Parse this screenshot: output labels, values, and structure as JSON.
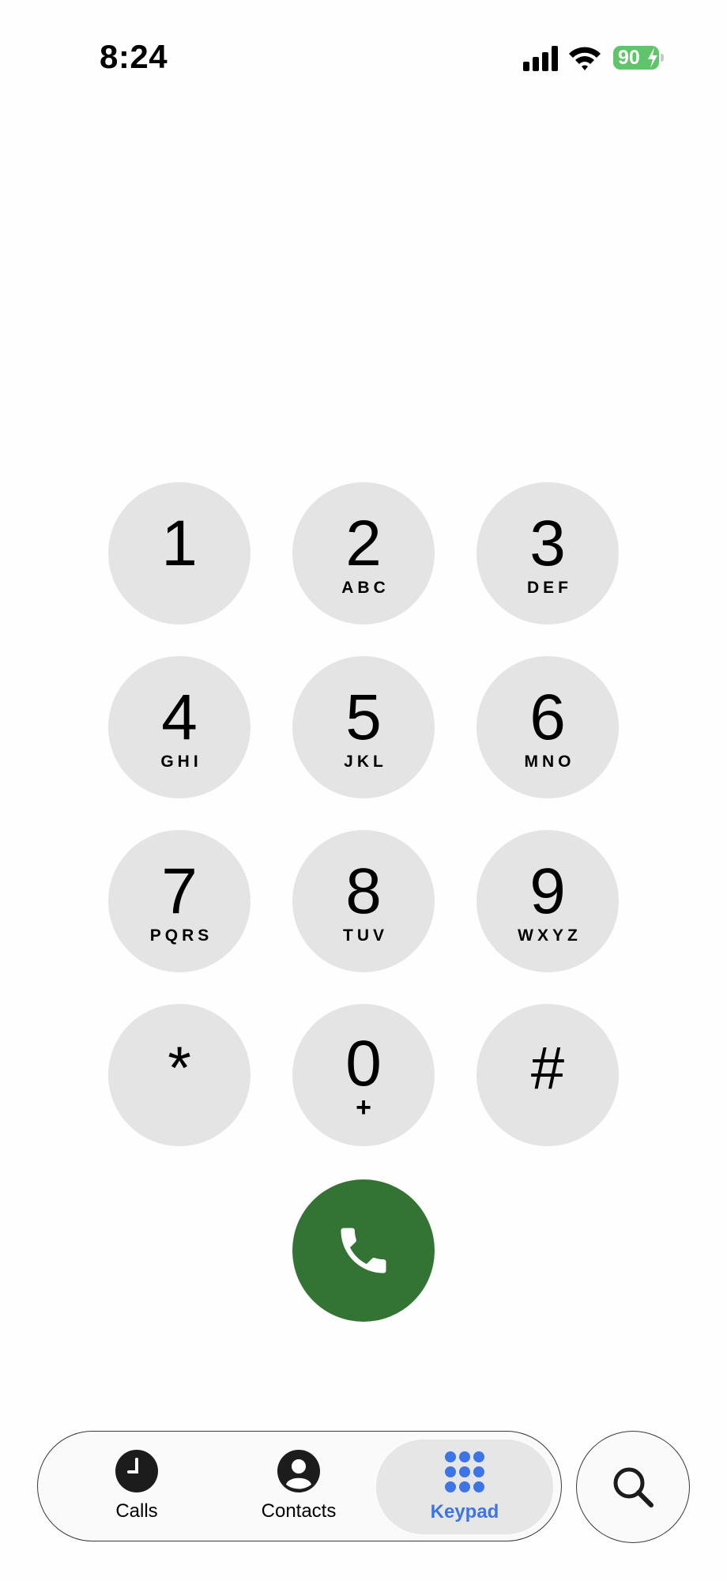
{
  "status_bar": {
    "time": "8:24",
    "battery_level": "90",
    "icons": [
      "cellular-signal-icon",
      "wifi-icon",
      "battery-charging-icon"
    ]
  },
  "keypad": {
    "keys": [
      {
        "digit": "1",
        "letters": ""
      },
      {
        "digit": "2",
        "letters": "ABC"
      },
      {
        "digit": "3",
        "letters": "DEF"
      },
      {
        "digit": "4",
        "letters": "GHI"
      },
      {
        "digit": "5",
        "letters": "JKL"
      },
      {
        "digit": "6",
        "letters": "MNO"
      },
      {
        "digit": "7",
        "letters": "PQRS"
      },
      {
        "digit": "8",
        "letters": "TUV"
      },
      {
        "digit": "9",
        "letters": "WXYZ"
      },
      {
        "digit": "*",
        "letters": ""
      },
      {
        "digit": "0",
        "letters": "+"
      },
      {
        "digit": "#",
        "letters": ""
      }
    ],
    "call_button_icon": "phone-icon"
  },
  "tab_bar": {
    "tabs": [
      {
        "label": "Calls",
        "icon": "clock-icon",
        "active": false
      },
      {
        "label": "Contacts",
        "icon": "person-icon",
        "active": false
      },
      {
        "label": "Keypad",
        "icon": "keypad-grid-icon",
        "active": true
      }
    ],
    "search_icon": "search-icon"
  },
  "colors": {
    "key_background": "#e4e4e4",
    "call_button": "#337434",
    "active_tab": "#3d74e6",
    "battery": "#5fc46a"
  }
}
